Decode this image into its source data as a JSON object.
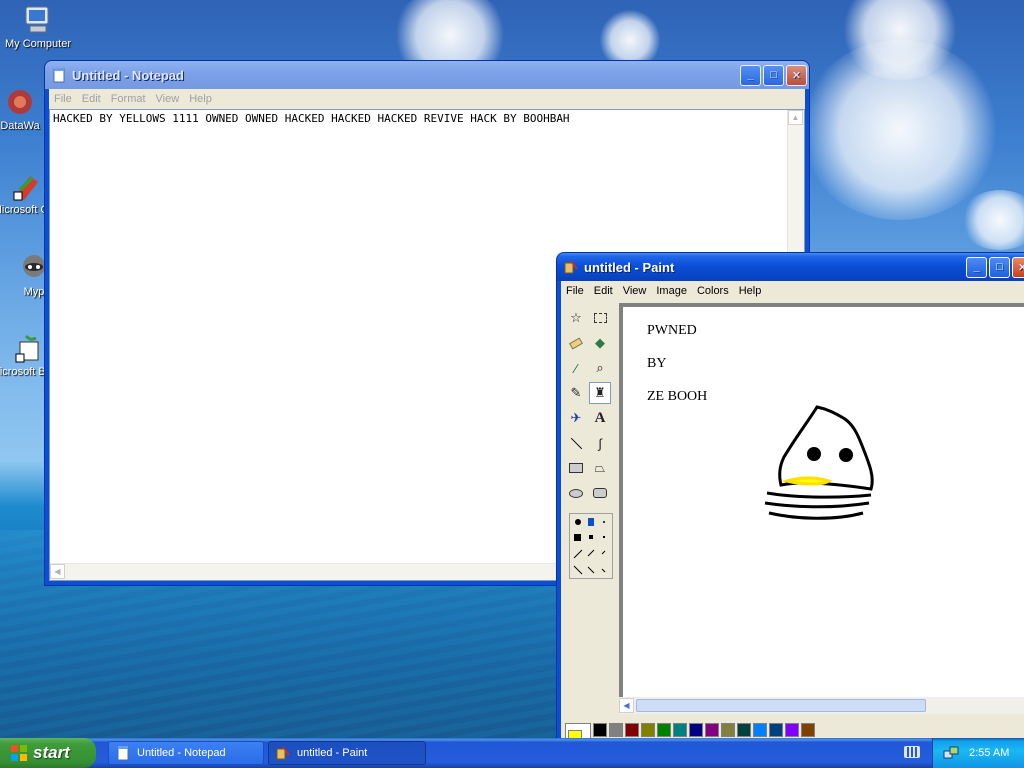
{
  "desktop": {
    "icons": [
      {
        "label": "My Computer",
        "icon": "my-computer-icon"
      },
      {
        "label": "DataWa",
        "icon": "datawa-icon"
      },
      {
        "label": "Microsoft C++",
        "icon": "msvc-icon"
      },
      {
        "label": "Myp",
        "icon": "myp-icon"
      },
      {
        "label": "Microsoft Basic",
        "icon": "msbasic-icon"
      }
    ]
  },
  "notepad": {
    "title": "Untitled - Notepad",
    "menu": [
      "File",
      "Edit",
      "Format",
      "View",
      "Help"
    ],
    "content": "HACKED BY YELLOWS 1111 OWNED OWNED HACKED HACKED HACKED REVIVE HACK BY BOOHBAH"
  },
  "paint": {
    "title": "untitled - Paint",
    "menu": [
      "File",
      "Edit",
      "View",
      "Image",
      "Colors",
      "Help"
    ],
    "canvas_text": [
      "PWNED",
      "BY",
      "ZE BOOH"
    ],
    "primary_color": "#ffff00",
    "palette": [
      "#000000",
      "#808080",
      "#800000",
      "#808000",
      "#008000",
      "#008080",
      "#000080",
      "#800080",
      "#808040",
      "#004040",
      "#0080ff",
      "#004080",
      "#8000ff",
      "#804000"
    ]
  },
  "taskbar": {
    "start_label": "start",
    "tasks": [
      {
        "label": "Untitled - Notepad",
        "active": false
      },
      {
        "label": "untitled - Paint",
        "active": true
      }
    ],
    "clock": "2:55 AM"
  }
}
